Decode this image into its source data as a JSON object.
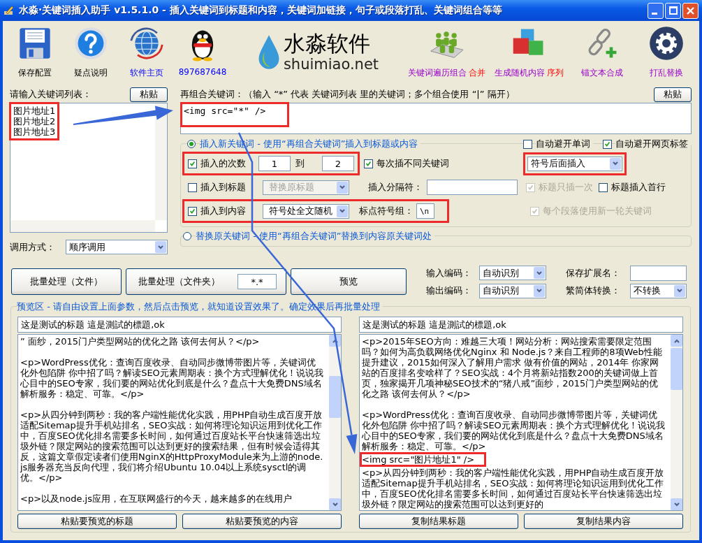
{
  "window": {
    "title": "水淼·关键词插入助手 v1.5.1.0 - 插入关键词到标题和内容，关键词加链接，句子或段落打乱、关键词组合等等"
  },
  "toolbar": [
    {
      "kind": "save",
      "label": "保存配置"
    },
    {
      "kind": "help",
      "label": "疑点说明"
    },
    {
      "kind": "globe",
      "label": "软件主页"
    },
    {
      "kind": "penguin",
      "label": "897687648"
    },
    {
      "kind": "logo",
      "label": "水淼软件",
      "sub": "shuimiao.net"
    },
    {
      "kind": "people",
      "label": "关键词遍历组合",
      "extra": "合并"
    },
    {
      "kind": "cubes",
      "label": "生成随机内容",
      "extra": "序列"
    },
    {
      "kind": "chain",
      "label": "锚文本合成"
    },
    {
      "kind": "gear",
      "label": "打乱替换"
    }
  ],
  "keywords": {
    "label": "请输入关键词列表：",
    "paste": "粘贴",
    "lines": [
      "图片地址1",
      "图片地址2",
      "图片地址3"
    ],
    "highlighted": true
  },
  "call_mode": {
    "label": "调用方式：",
    "value": "顺序调用"
  },
  "recombine": {
    "label": "再组合关键词：（输入 “*” 代表 关键词列表 里的关键词；多个组合使用 “|” 隔开）",
    "paste": "粘贴",
    "value": "<img src=\"*\" />",
    "highlighted": true
  },
  "insert_mode": {
    "label": "插入新关键词 - 使用“再组合关键词”插入到标题或内容",
    "selected": true
  },
  "avoid_word": {
    "label": "自动避开单词",
    "checked": false
  },
  "avoid_tags": {
    "label": "自动避开网页标签",
    "checked": true
  },
  "count": {
    "label": "插入的次数",
    "checked": true,
    "from": "1",
    "to_label": "到",
    "to": "2",
    "highlighted": true
  },
  "different": {
    "label": "每次插不同关键词",
    "checked": true
  },
  "position": {
    "value": "符号后面插入",
    "highlighted": true
  },
  "to_title": {
    "label": "插入到标题",
    "checked": false,
    "select": "替换原标题",
    "select_disabled": true
  },
  "separator": {
    "label": "插入分隔符："
  },
  "title_once": {
    "label": "标题只插一次",
    "checked": true,
    "disabled": true
  },
  "title_first": {
    "label": "标题插入首行",
    "checked": false
  },
  "to_content": {
    "label": "插入到内容",
    "checked": true,
    "select": "符号处全文随机",
    "punct_label": "标点符号组：",
    "punct": "\\n",
    "highlighted": true
  },
  "new_round": {
    "label": "每个段落使用新一轮关键词",
    "checked": true,
    "disabled": true
  },
  "replace_mode": {
    "label": "替换原关键词 - 使用“再组合关键词”替换到内容原关键词处",
    "selected": false
  },
  "batch": {
    "file": "批量处理（文件）",
    "folder": "批量处理（文件夹）",
    "pattern": "*.*",
    "preview": "预览"
  },
  "encoding": {
    "input_label": "输入编码：",
    "input": "自动识别",
    "output_label": "输出编码：",
    "output": "自动识别",
    "ext_label": "保存扩展名：",
    "convert_label": "繁简体转换：",
    "convert": "不转换"
  },
  "preview": {
    "legend": "预览区 - 请自由设置上面参数，然后点击预览，就知道设置效果了。确定效果后再批量处理",
    "source": {
      "title": "这是测试的标题 這是測試的標題,ok",
      "paragraphs": [
        {
          "kind": "paragraph",
          "text": "” 面纱，2015门户类型网站的优化之路 该何去何从？</p>",
          "highlighted": false
        },
        {
          "kind": "paragraph",
          "text": "<p>WordPress优化：查询百度收录、自动同步微博带图片等，关键词优化外包陷阱 你中招了吗？解读SEO元素周期表：换个方式理解优化！说说我心目中的SEO专家，我们要的网站优化到底是什么？盘点十大免费DNS域名解析服务：稳定、可靠。</p>",
          "highlighted": false
        },
        {
          "kind": "paragraph",
          "text": "<p>从四分钟到两秒：我的客户端性能优化实践，用PHP自动生成百度开放适配Sitemap提升手机站排名，SEO实战：如何将理论知识运用到优化工作中，百度SEO优化排名需要多长时间，如何通过百度站长平台快速筛选出垃圾外链？限定网站的搜索范围可以达到更好的搜索结果，但有时候会适得其反，这篇文章假定读者们使用NginX的HttpProxyModule来为上游的node.js服务器充当反向代理，我们将介绍Ubuntu 10.04以上系统sysctl的调优。</p>",
          "highlighted": false
        },
        {
          "kind": "paragraph",
          "text": "<p>以及node.js应用，在互联网盛行的今天，越来越多的在线用户",
          "highlighted": false
        }
      ],
      "buttons": [
        "粘贴要预览的标题",
        "粘贴要预览的内容"
      ]
    },
    "result": {
      "title": "这是测试的标题 這是測試的標題,ok",
      "paragraphs": [
        {
          "kind": "paragraph",
          "text": "<p>2015年SEO方向：难越三大项！网站分析：网站搜索需要限定范围吗？如何为高负载网络优化Nginx 和 Node.js？来自工程师的8项Web性能提升建议，2015如何深入了解用户需求 做有价值的网站，2014年 你家网站的百度排名变啥样了？SEO实战：4个月将新站指数200的关键词做上首页，独家揭开几项神秘SEO技术的“猪八戒”面纱，2015门户类型网站的优化之路 该何去何从？</p>",
          "highlighted": false
        },
        {
          "kind": "paragraph",
          "text": "<p>WordPress优化：查询百度收录、自动同步微博带图片等，关键词优化外包陷阱 你中招了吗？解读SEO元素周期表：换个方式理解优化！说说我心目中的SEO专家，我们要的网站优化到底是什么？盘点十大免费DNS域名解析服务：稳定、可靠。</p>",
          "highlighted": false
        },
        {
          "kind": "tag",
          "text": "<img src=\"图片地址1\" />",
          "highlighted": true
        },
        {
          "kind": "tag",
          "text": "<p>从四分钟到两秒：我的客户端性能优化实践，用PHP自动生成百度开放适配Sitemap提升手机站排名，SEO实战：如何将理论知识运用到优化工作中，百度SEO优化排名需要多长时间，如何通过百度站长平台快速筛选出垃圾外链？限定网站的搜索范围可以达到更好的",
          "highlighted": false
        }
      ],
      "buttons": [
        "复制结果标题",
        "复制结果内容"
      ]
    }
  }
}
